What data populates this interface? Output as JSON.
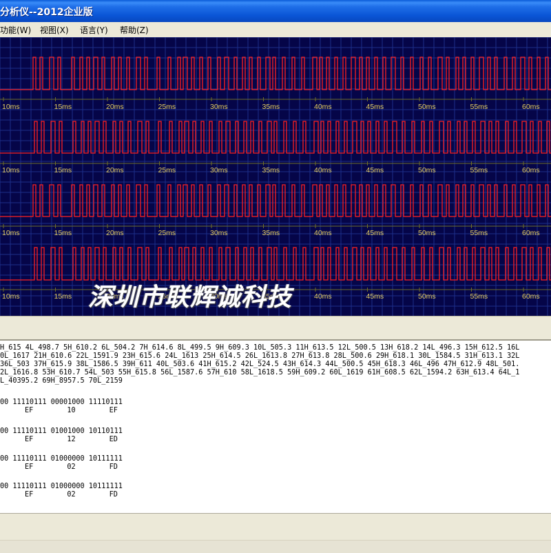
{
  "window": {
    "title": "分析仪--2012企业版"
  },
  "menu": [
    {
      "label": "功能(W)"
    },
    {
      "label": "视图(X)"
    },
    {
      "label": "语言(Y)"
    },
    {
      "label": "帮助(Z)"
    }
  ],
  "colors": {
    "scope_background": "#050548",
    "grid": "#1d2f8a",
    "trace": "#ff2020",
    "baseline": "#707028",
    "tick_label": "#e8d060"
  },
  "time_axis_labels": [
    "10ms",
    "15ms",
    "20ms",
    "25ms",
    "30ms",
    "35ms",
    "40ms",
    "45ms",
    "50ms",
    "55ms",
    "60ms"
  ],
  "watermark": "深圳市联辉诚科技",
  "raw_lines": [
    "H_615 4L_498.7 5H_610.2 6L_504.2 7H_614.6 8L_499.5 9H_609.3 10L_505.3 11H_613.5 12L_500.5 13H_618.2 14L_496.3 15H_612.5 16L",
    "0L_1617 21H_610.6 22L_1591.9 23H_615.6 24L_1613 25H_614.5 26L_1613.8 27H_613.8 28L_500.6 29H_618.1 30L_1584.5 31H_613.1 32L",
    "36L_503 37H_615.9 38L_1586.5 39H_611 40L_503.6 41H_615.2 42L_524.5 43H_614.3 44L_500.5 45H_618.3 46L_496 47H_612.9 48L_501.",
    "2L_1616.8 53H_610.7 54L_503 55H_615.8 56L_1587.6 57H_610 58L_1618.5 59H_609.2 60L_1619 61H_608.5 62L_1594.2 63H_613.4 64L_1",
    "L_40395.2 69H_8957.5 70L_2159"
  ],
  "decoded": [
    {
      "bits": "00 11110111 00001000 11110111",
      "hex": "EF        10        EF"
    },
    {
      "bits": "00 11110111 01001000 10110111",
      "hex": "EF        12        ED"
    },
    {
      "bits": "00 11110111 01000000 10111111",
      "hex": "EF        02        FD"
    },
    {
      "bits": "00 11110111 01000000 10111111",
      "hex": "EF        02        FD"
    }
  ]
}
